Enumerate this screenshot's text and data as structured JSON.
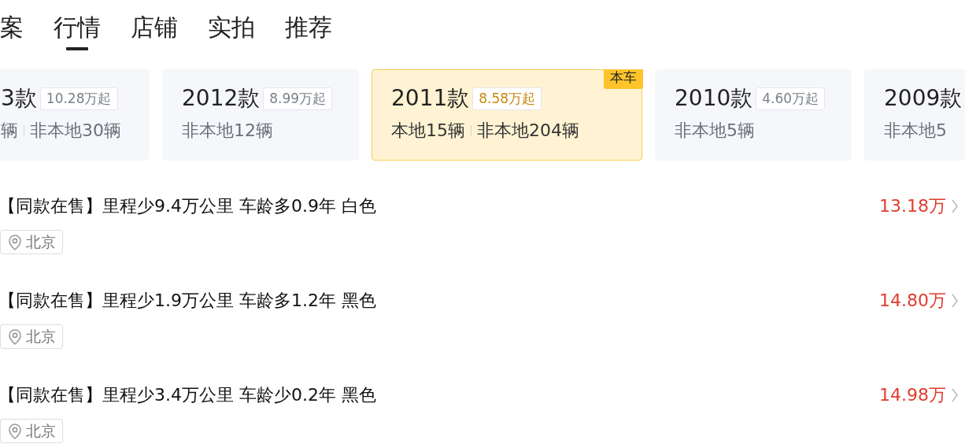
{
  "tabs": [
    {
      "label": "案",
      "selected": false
    },
    {
      "label": "行情",
      "selected": true
    },
    {
      "label": "店铺",
      "selected": false
    },
    {
      "label": "实拍",
      "selected": false
    },
    {
      "label": "推荐",
      "selected": false
    }
  ],
  "versions": [
    {
      "year": "3款",
      "price": "10.28万起",
      "counts": [
        "辆",
        "非本地30辆"
      ],
      "selected": false
    },
    {
      "year": "2012款",
      "price": "8.99万起",
      "counts": [
        "非本地12辆"
      ],
      "selected": false
    },
    {
      "year": "2011款",
      "price": "8.58万起",
      "counts": [
        "本地15辆",
        "非本地204辆"
      ],
      "selected": true,
      "badge": "本车"
    },
    {
      "year": "2010款",
      "price": "4.60万起",
      "counts": [
        "非本地5辆"
      ],
      "selected": false
    },
    {
      "year": "2009款",
      "counts": [
        "非本地5"
      ],
      "selected": false
    }
  ],
  "listings": [
    {
      "title": "【同款在售】里程少9.4万公里 车龄多0.9年 白色",
      "price": "13.18万",
      "location": "北京"
    },
    {
      "title": "【同款在售】里程少1.9万公里 车龄多1.2年 黑色",
      "price": "14.80万",
      "location": "北京"
    },
    {
      "title": "【同款在售】里程少3.4万公里 车龄少0.2年 黑色",
      "price": "14.98万",
      "location": "北京"
    }
  ]
}
